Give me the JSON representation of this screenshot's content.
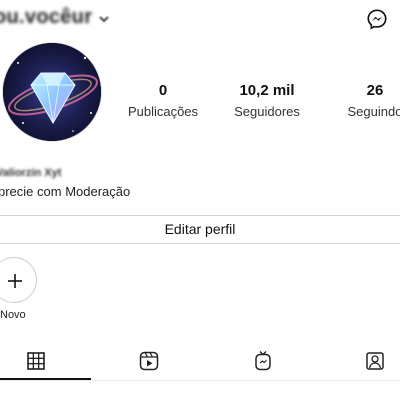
{
  "header": {
    "username": "ou.vocêur",
    "chevron_icon": "chevron-down-icon",
    "messenger_icon": "messenger-icon"
  },
  "profile": {
    "avatar_alt": "diamond-avatar",
    "display_name": "Valiorzin Xyt",
    "bio": "precie com Moderação"
  },
  "stats": {
    "posts": {
      "value": "0",
      "label": "Publicações"
    },
    "followers": {
      "value": "10,2 mil",
      "label": "Seguidores"
    },
    "following": {
      "value": "26",
      "label": "Seguindo"
    }
  },
  "actions": {
    "edit_profile_label": "Editar perfil"
  },
  "highlights": {
    "new_label": "Novo"
  },
  "tabs": [
    {
      "icon": "grid-icon",
      "active": true
    },
    {
      "icon": "reels-icon",
      "active": false
    },
    {
      "icon": "igtv-icon",
      "active": false
    },
    {
      "icon": "tagged-icon",
      "active": false
    }
  ],
  "colors": {
    "text": "#111111",
    "border": "#d4d4d4",
    "accent_avatar_bg": "#0c0f2a"
  }
}
